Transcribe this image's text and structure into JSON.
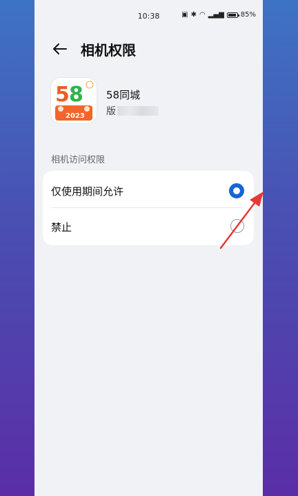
{
  "status_bar": {
    "time": "10:38",
    "battery": "85%"
  },
  "header": {
    "title": "相机权限"
  },
  "app": {
    "name": "58同城",
    "version_label": "版",
    "icon_text": "58",
    "icon_year": "2023"
  },
  "section": {
    "title": "相机访问权限"
  },
  "options": [
    {
      "label": "仅使用期间允许",
      "selected": true
    },
    {
      "label": "禁止",
      "selected": false
    }
  ],
  "colors": {
    "accent": "#1565d8",
    "annotation_arrow": "#e53935"
  }
}
